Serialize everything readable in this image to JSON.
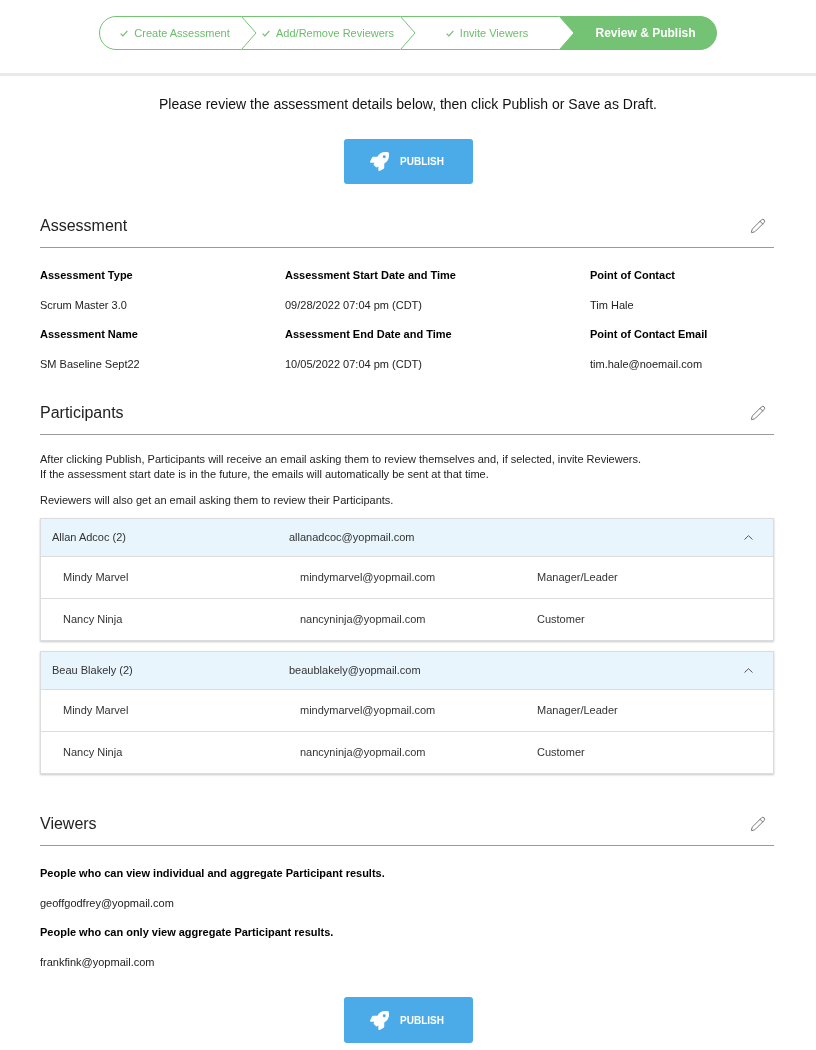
{
  "stepper": {
    "steps": [
      {
        "label": "Create Assessment",
        "completed": true,
        "selected": false
      },
      {
        "label": "Add/Remove Reviewers",
        "completed": true,
        "selected": false
      },
      {
        "label": "Invite Viewers",
        "completed": true,
        "selected": false
      },
      {
        "label": "Review & Publish",
        "completed": false,
        "selected": true
      }
    ]
  },
  "instructions": "Please review the assessment details below, then click Publish or Save as Draft.",
  "publish_top": {
    "label": "PUBLISH"
  },
  "assessment": {
    "title": "Assessment",
    "fields": [
      {
        "label": "Assessment Type",
        "value": "Scrum Master 3.0"
      },
      {
        "label": "Assessment Start Date and Time",
        "value": "09/28/2022 07:04 pm (CDT)"
      },
      {
        "label": "Point of Contact",
        "value": "Tim Hale"
      },
      {
        "label": "Assessment Name",
        "value": "SM Baseline Sept22"
      },
      {
        "label": "Assessment End Date and Time",
        "value": "10/05/2022 07:04 pm (CDT)"
      },
      {
        "label": "Point of Contact Email",
        "value": "tim.hale@noemail.com"
      }
    ]
  },
  "participants": {
    "title": "Participants",
    "notes": [
      {
        "lines": [
          "After clicking Publish, Participants will receive an email asking them to review themselves and, if selected, invite Reviewers.",
          "If the assessment start date is in the future, the emails will automatically be sent at that time."
        ]
      },
      {
        "lines": [
          "Reviewers will also get an email asking them to review their Participants."
        ]
      }
    ],
    "groups": [
      {
        "name": "Allan Adcoc (2)",
        "email": "allanadcoc@yopmail.com",
        "expanded": true,
        "reviewers": [
          {
            "name": "Mindy Marvel",
            "email": "mindymarvel@yopmail.com",
            "role": "Manager/Leader"
          },
          {
            "name": "Nancy Ninja",
            "email": "nancyninja@yopmail.com",
            "role": "Customer"
          }
        ]
      },
      {
        "name": "Beau Blakely (2)",
        "email": "beaublakely@yopmail.com",
        "expanded": true,
        "reviewers": [
          {
            "name": "Mindy Marvel",
            "email": "mindymarvel@yopmail.com",
            "role": "Manager/Leader"
          },
          {
            "name": "Nancy Ninja",
            "email": "nancyninja@yopmail.com",
            "role": "Customer"
          }
        ]
      }
    ]
  },
  "viewers": {
    "title": "Viewers",
    "groups": [
      {
        "heading": "People who can view individual and aggregate Participant results.",
        "emails": [
          "geoffgodfrey@yopmail.com"
        ]
      },
      {
        "heading": "People who can only view aggregate Participant results.",
        "emails": [
          "frankfink@yopmail.com"
        ]
      }
    ]
  },
  "publish_bottom": {
    "label": "PUBLISH"
  }
}
